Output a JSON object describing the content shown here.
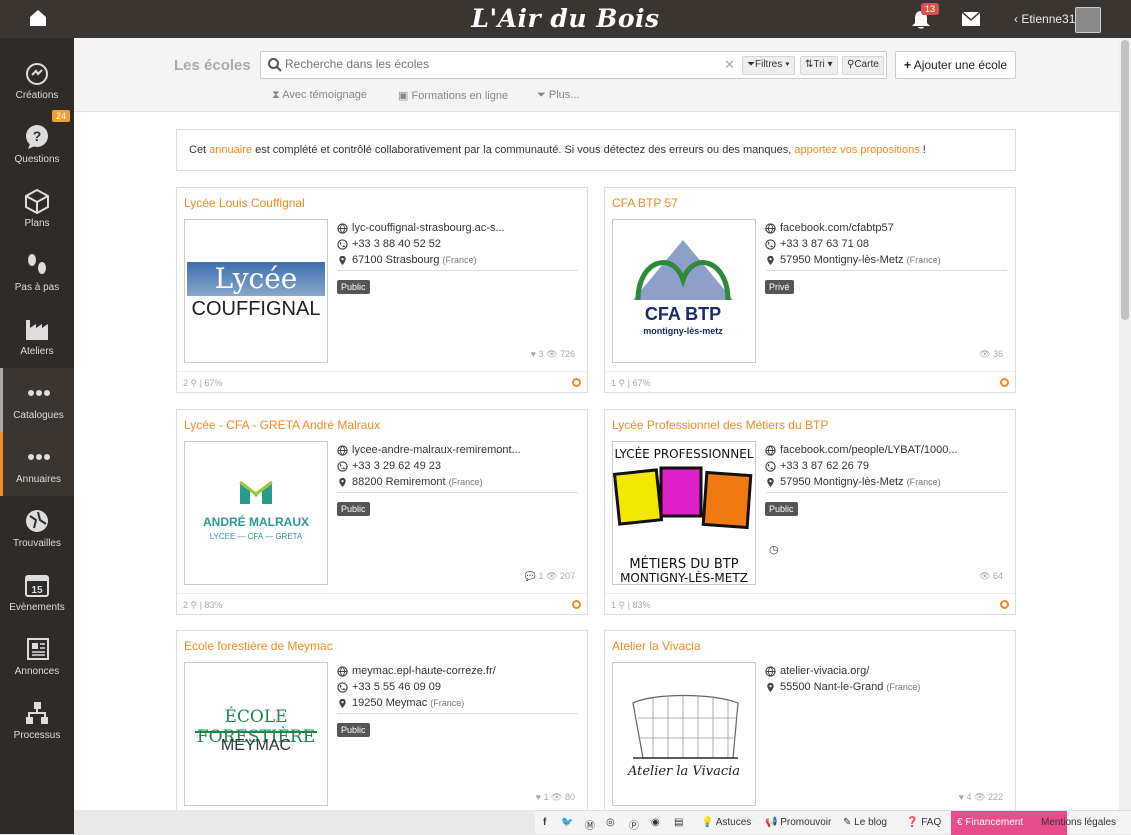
{
  "header": {
    "brand": "L'Air du Bois",
    "notif_count": "13",
    "username": "Etienne31"
  },
  "sidebar": {
    "items": [
      {
        "label": "Créations",
        "icon": "creations-icon",
        "badge": ""
      },
      {
        "label": "Questions",
        "icon": "questions-icon",
        "badge": "24"
      },
      {
        "label": "Plans",
        "icon": "plans-icon",
        "badge": ""
      },
      {
        "label": "Pas à pas",
        "icon": "steps-icon",
        "badge": ""
      },
      {
        "label": "Ateliers",
        "icon": "workshop-icon",
        "badge": ""
      },
      {
        "label": "Catalogues",
        "icon": "dots-icon",
        "badge": ""
      },
      {
        "label": "Annuaires",
        "icon": "dots-icon",
        "badge": ""
      },
      {
        "label": "Trouvailles",
        "icon": "finds-icon",
        "badge": ""
      },
      {
        "label": "Evènements",
        "icon": "calendar-icon",
        "badge": ""
      },
      {
        "label": "Annonces",
        "icon": "ads-icon",
        "badge": ""
      },
      {
        "label": "Processus",
        "icon": "process-icon",
        "badge": ""
      }
    ],
    "calendar_day": "15"
  },
  "main": {
    "title": "Les écoles",
    "search_placeholder": "Recherche dans les écoles",
    "filters_label": "Filtres",
    "sort_label": "Tri",
    "map_label": "Carte",
    "add_label": "Ajouter une école",
    "subfilters": [
      "Avec témoignage",
      "Formations en ligne",
      "Plus..."
    ],
    "notice": {
      "pre": "Cet ",
      "link1": "annuaire",
      "mid": " est complété et contrôlé collaborativement par la communauté. Si vous détectez des erreurs ou des manques, ",
      "link2": "apportez vos propositions",
      "post": " !"
    }
  },
  "cards": [
    {
      "title": "Lycée Louis Couffignal",
      "web": "lyc-couffignal-strasbourg.ac-s...",
      "phone": "+33 3 88 40 52 52",
      "city": "67100 Strasbourg",
      "country": "(France)",
      "tag": "Public",
      "likes": "3",
      "views": "726",
      "comments": "",
      "foot_count": "2",
      "foot_pct": "67%",
      "logo_text1": "Lycée",
      "logo_text2": "COUFFIGNAL"
    },
    {
      "title": "CFA BTP 57",
      "web": "facebook.com/cfabtp57",
      "phone": "+33 3 87 63 71 08",
      "city": "57950 Montigny-lès-Metz",
      "country": "(France)",
      "tag": "Privé",
      "likes": "",
      "views": "36",
      "comments": "",
      "foot_count": "1",
      "foot_pct": "67%",
      "logo_text1": "CFA BTP",
      "logo_text2": "montigny-lès-metz"
    },
    {
      "title": "Lycée - CFA - GRETA André Malraux",
      "web": "lycee-andre-malraux-remiremont...",
      "phone": "+33 3 29 62 49 23",
      "city": "88200 Remiremont",
      "country": "(France)",
      "tag": "Public",
      "likes": "",
      "views": "207",
      "comments": "1",
      "foot_count": "2",
      "foot_pct": "83%",
      "logo_text1": "ANDRÉ MALRAUX",
      "logo_text2": "LYCEE — CFA — GRETA"
    },
    {
      "title": "Lycée Professionnel des Métiers du BTP",
      "web": "facebook.com/people/LYBAT/1000...",
      "phone": "+33 3 87 62 26 79",
      "city": "57950 Montigny-lès-Metz",
      "country": "(France)",
      "tag": "Public",
      "likes": "",
      "views": "64",
      "comments": "",
      "foot_count": "1",
      "foot_pct": "83%",
      "logo_text1": "LYCÉE PROFESSIONNEL",
      "logo_text2": "MÉTIERS DU BTP",
      "logo_text3": "MONTIGNY-LÈS-METZ"
    },
    {
      "title": "Ecole forestière de Meymac",
      "web": "meymac.epl-haute-correze.fr/",
      "phone": "+33 5 55 46 09 09",
      "city": "19250 Meymac",
      "country": "(France)",
      "tag": "Public",
      "likes": "1",
      "views": "80",
      "comments": "",
      "logo_text1": "ÉCOLE FORESTIÈRE",
      "logo_text2": "MEYMAC"
    },
    {
      "title": "Atelier la Vivacia",
      "web": "atelier-vivacia.org/",
      "phone": "",
      "city": "55500 Nant-le-Grand",
      "country": "(France)",
      "tag": "",
      "likes": "4",
      "views": "222",
      "comments": "",
      "logo_text1": "Atelier la Vivacia"
    }
  ],
  "footer": {
    "astuces": "Astuces",
    "promouvoir": "Promouvoir",
    "blog": "Le blog",
    "faq": "FAQ",
    "financement": "Financement",
    "mentions": "Mentions légales"
  },
  "colors": {
    "accent": "#f08a24",
    "dark": "#2f2b28",
    "funding": "#e84c8a"
  }
}
